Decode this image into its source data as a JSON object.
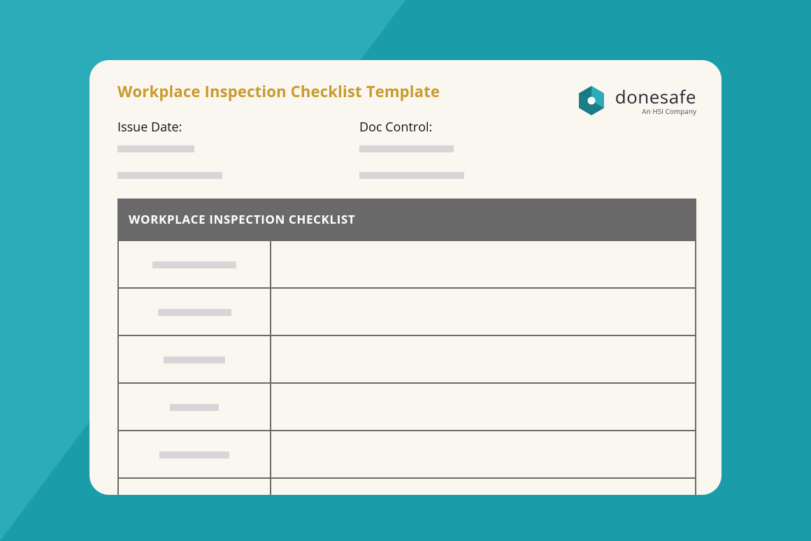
{
  "header": {
    "title": "Workplace Inspection Checklist Template"
  },
  "meta": {
    "issue_date_label": "Issue Date:",
    "doc_control_label": "Doc Control:"
  },
  "brand": {
    "name": "donesafe",
    "subline": "An HSI Company"
  },
  "table": {
    "title": "WORKPLACE INSPECTION CHECKLIST"
  }
}
